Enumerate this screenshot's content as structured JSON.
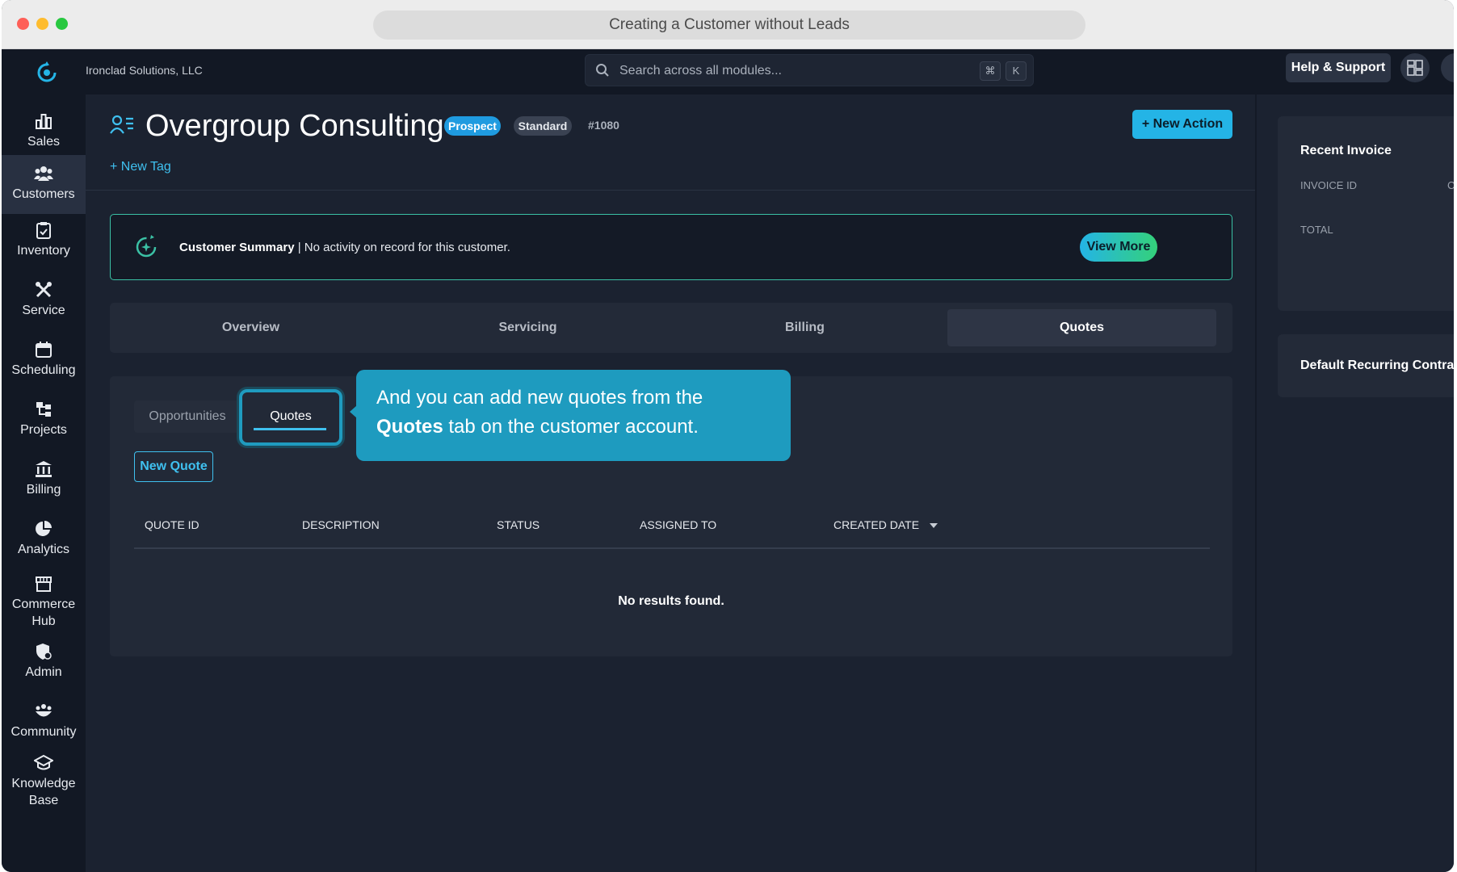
{
  "browser": {
    "title": "Creating a Customer without Leads"
  },
  "topbar": {
    "org_name": "Ironclad Solutions, LLC",
    "search_placeholder": "Search across all modules...",
    "shortcut_cmd": "⌘",
    "shortcut_key": "K",
    "help_label": "Help & Support"
  },
  "sidebar": {
    "items": [
      {
        "label": "Sales",
        "icon": "bar-chart-icon"
      },
      {
        "label": "Customers",
        "icon": "people-icon"
      },
      {
        "label": "Inventory",
        "icon": "clipboard-icon"
      },
      {
        "label": "Service",
        "icon": "tools-icon"
      },
      {
        "label": "Scheduling",
        "icon": "calendar-icon"
      },
      {
        "label": "Projects",
        "icon": "sitemap-icon"
      },
      {
        "label": "Billing",
        "icon": "bank-icon"
      },
      {
        "label": "Analytics",
        "icon": "pie-chart-icon"
      },
      {
        "label": "Commerce Hub",
        "icon": "store-icon"
      },
      {
        "label": "Admin",
        "icon": "shield-user-icon"
      },
      {
        "label": "Community",
        "icon": "community-icon"
      },
      {
        "label": "Knowledge Base",
        "icon": "graduation-cap-icon"
      }
    ],
    "active": "Customers"
  },
  "customer": {
    "name": "Overgroup Consulting",
    "badge_status": "Prospect",
    "badge_tier": "Standard",
    "record_id": "#1080",
    "new_action_label": "New Action",
    "new_tag_label": "New Tag"
  },
  "summary": {
    "label": "Customer Summary",
    "separator": " | ",
    "text": "No activity on record for this customer.",
    "view_more_label": "View More"
  },
  "tabs": {
    "items": [
      "Overview",
      "Servicing",
      "Billing",
      "Quotes"
    ],
    "active": "Quotes"
  },
  "quotes_panel": {
    "subtabs": [
      "Opportunities",
      "Quotes"
    ],
    "active_subtab": "Quotes",
    "new_quote_label": "New Quote",
    "columns": [
      "QUOTE ID",
      "DESCRIPTION",
      "STATUS",
      "ASSIGNED TO",
      "CREATED DATE"
    ],
    "sorted_column": "CREATED DATE",
    "empty_text": "No results found."
  },
  "callout": {
    "text_before": "And you can add new quotes from the ",
    "text_bold": "Quotes",
    "text_after": " tab on the customer account."
  },
  "right_rail": {
    "card1_title": "Recent Invoice",
    "card1_label_invoice": "INVOICE ID",
    "card1_label_partial": "CI",
    "card1_label_total": "TOTAL",
    "card2_title": "Default Recurring Contract"
  },
  "colors": {
    "accent": "#24b4e6",
    "prospect_badge": "#1f9be0",
    "summary_border": "#3bc1a5",
    "callout_bg": "#1e9bbf"
  }
}
